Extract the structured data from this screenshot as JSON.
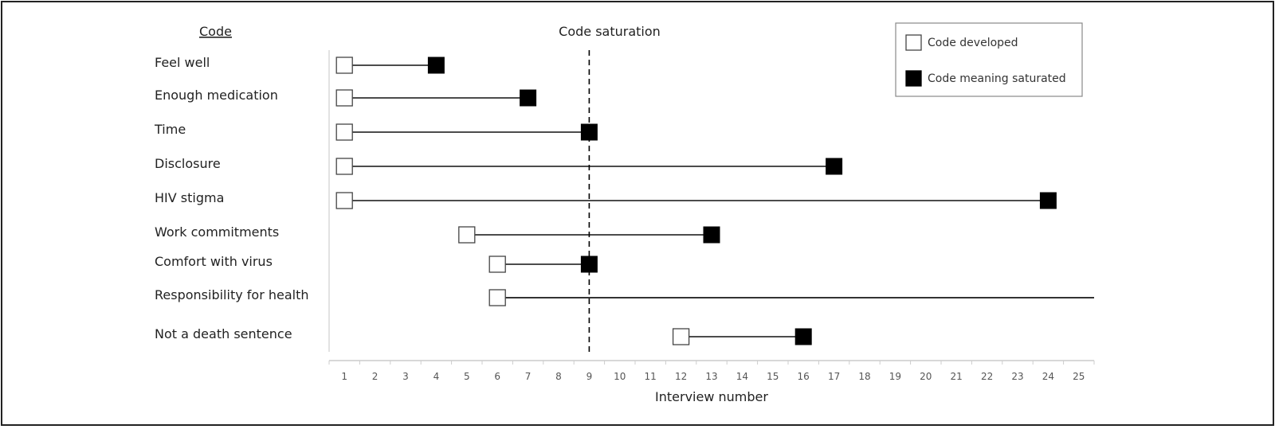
{
  "chart_data": {
    "type": "scatter",
    "subtype": "dumbbell-timeline",
    "title": "Code saturation",
    "row_header": "Code",
    "xlabel": "Interview number",
    "ylabel": "",
    "x_ticks": [
      1,
      2,
      3,
      4,
      5,
      6,
      7,
      8,
      9,
      10,
      11,
      12,
      13,
      14,
      15,
      16,
      17,
      18,
      19,
      20,
      21,
      22,
      23,
      24,
      25
    ],
    "xlim": [
      1,
      25
    ],
    "grid": false,
    "legend_position": "top-right",
    "legend": [
      {
        "key": "developed",
        "label": "Code developed",
        "marker": "open-square"
      },
      {
        "key": "saturated",
        "label": "Code meaning saturated",
        "marker": "filled-square"
      }
    ],
    "reference_line": {
      "x": 9,
      "style": "dashed",
      "label": "Code saturation"
    },
    "codes": [
      {
        "name": "Feel well",
        "developed": 1,
        "saturated": 4
      },
      {
        "name": "Enough medication",
        "developed": 1,
        "saturated": 7
      },
      {
        "name": "Time",
        "developed": 1,
        "saturated": 9
      },
      {
        "name": "Disclosure",
        "developed": 1,
        "saturated": 17
      },
      {
        "name": "HIV stigma",
        "developed": 1,
        "saturated": 24
      },
      {
        "name": "Work commitments",
        "developed": 5,
        "saturated": 13
      },
      {
        "name": "Comfort with virus",
        "developed": 6,
        "saturated": 9
      },
      {
        "name": "Responsibility for health",
        "developed": 6,
        "saturated": null,
        "extends_beyond": 25
      },
      {
        "name": "Not a death sentence",
        "developed": 12,
        "saturated": 16
      }
    ]
  },
  "colors": {
    "developed_fill": "#ffffff",
    "saturated_fill": "#000000",
    "line": "#333333",
    "axis": "#cccccc"
  }
}
